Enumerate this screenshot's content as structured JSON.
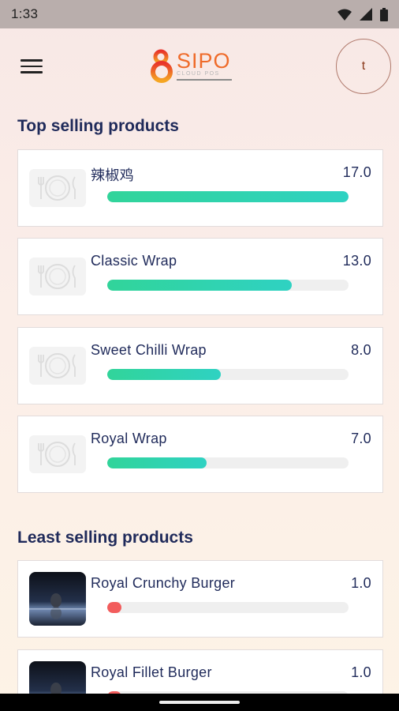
{
  "status_bar": {
    "time": "1:33",
    "icons": [
      "wifi-icon",
      "signal-icon",
      "battery-icon"
    ]
  },
  "header": {
    "logo_name": "SIPO",
    "logo_sub": "CLOUD POS",
    "avatar_initial": "t"
  },
  "top_selling": {
    "title": "Top selling products",
    "max_value": 17,
    "items": [
      {
        "name": "辣椒鸡",
        "value": "17.0",
        "fraction": 1.0
      },
      {
        "name": "Classic Wrap",
        "value": "13.0",
        "fraction": 0.765
      },
      {
        "name": "Sweet Chilli Wrap",
        "value": "8.0",
        "fraction": 0.471
      },
      {
        "name": "Royal Wrap",
        "value": "7.0",
        "fraction": 0.412
      }
    ]
  },
  "least_selling": {
    "title": "Least selling products",
    "items": [
      {
        "name": "Royal Crunchy Burger",
        "value": "1.0",
        "fraction": 0.06
      },
      {
        "name": "Royal Fillet Burger",
        "value": "1.0",
        "fraction": 0.06
      }
    ]
  },
  "colors": {
    "accent": "#ef6b2a",
    "bar_high": "#31d49a",
    "bar_low": "#f25c5c",
    "title": "#1f2a5a"
  }
}
